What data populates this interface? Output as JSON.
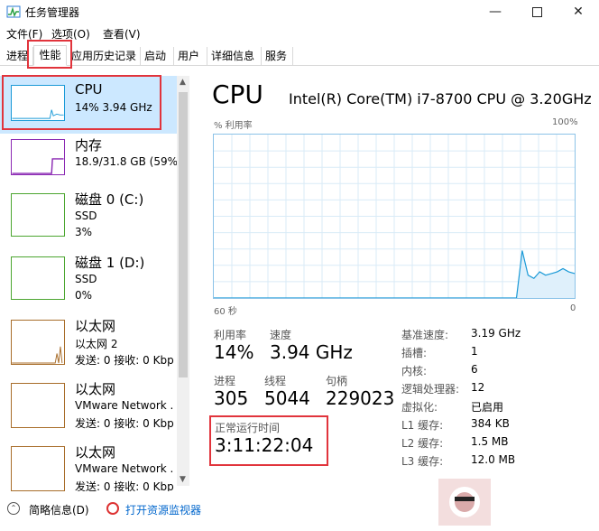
{
  "window": {
    "title": "任务管理器"
  },
  "menu": [
    "文件(F)",
    "选项(O)",
    "查看(V)"
  ],
  "tabs": [
    "进程",
    "性能",
    "应用历史记录",
    "启动",
    "用户",
    "详细信息",
    "服务"
  ],
  "sidebar": {
    "items": [
      {
        "title": "CPU",
        "sub1": "14%  3.94 GHz",
        "sub2": "",
        "color": "#1b9ad7"
      },
      {
        "title": "内存",
        "sub1": "18.9/31.8 GB (59%)",
        "sub2": "",
        "color": "#8b29b3"
      },
      {
        "title": "磁盘 0 (C:)",
        "sub1": "SSD",
        "sub2": "3%",
        "color": "#4ca630"
      },
      {
        "title": "磁盘 1 (D:)",
        "sub1": "SSD",
        "sub2": "0%",
        "color": "#4ca630"
      },
      {
        "title": "以太网",
        "sub1": "以太网 2",
        "sub2": "发送: 0 接收: 0 Kbp",
        "color": "#a86d2a"
      },
      {
        "title": "以太网",
        "sub1": "VMware Network .",
        "sub2": "发送: 0 接收: 0 Kbp",
        "color": "#a86d2a"
      },
      {
        "title": "以太网",
        "sub1": "VMware Network .",
        "sub2": "发送: 0 接收: 0 Kbp",
        "color": "#a86d2a"
      }
    ]
  },
  "main": {
    "heading": "CPU",
    "model": "Intel(R) Core(TM) i7-8700 CPU @ 3.20GHz",
    "graph": {
      "y_label": "% 利用率",
      "y_max": "100%",
      "x_left": "60 秒",
      "x_right": "0",
      "series_percent": [
        0,
        0,
        0,
        0,
        0,
        0,
        0,
        0,
        0,
        0,
        0,
        0,
        0,
        0,
        0,
        0,
        0,
        0,
        0,
        0,
        0,
        0,
        0,
        0,
        0,
        0,
        0,
        0,
        0,
        0,
        0,
        0,
        0,
        0,
        0,
        0,
        0,
        0,
        0,
        0,
        0,
        0,
        0,
        0,
        0,
        0,
        0,
        0,
        0,
        0,
        0,
        0,
        0,
        29,
        14,
        12,
        16,
        14,
        15,
        16,
        18,
        16,
        15
      ]
    },
    "stats": [
      {
        "label": "利用率",
        "value": "14%"
      },
      {
        "label": "速度",
        "value": "3.94 GHz"
      },
      {
        "label": "进程",
        "value": "305"
      },
      {
        "label": "线程",
        "value": "5044"
      },
      {
        "label": "句柄",
        "value": "229023"
      }
    ],
    "uptime": {
      "label": "正常运行时间",
      "value": "3:11:22:04"
    },
    "details": [
      {
        "label": "基准速度:",
        "value": "3.19 GHz"
      },
      {
        "label": "插槽:",
        "value": "1"
      },
      {
        "label": "内核:",
        "value": "6"
      },
      {
        "label": "逻辑处理器:",
        "value": "12"
      },
      {
        "label": "虚拟化:",
        "value": "已启用"
      },
      {
        "label": "L1 缓存:",
        "value": "384 KB"
      },
      {
        "label": "L2 缓存:",
        "value": "1.5 MB"
      },
      {
        "label": "L3 缓存:",
        "value": "12.0 MB"
      }
    ]
  },
  "bottom": {
    "summary": "简略信息(D)",
    "monitor": "打开资源监视器"
  },
  "colors": {
    "accent": "#1b9ad7",
    "highlight_box": "#e1343c",
    "selected_bg": "#cce8ff"
  }
}
